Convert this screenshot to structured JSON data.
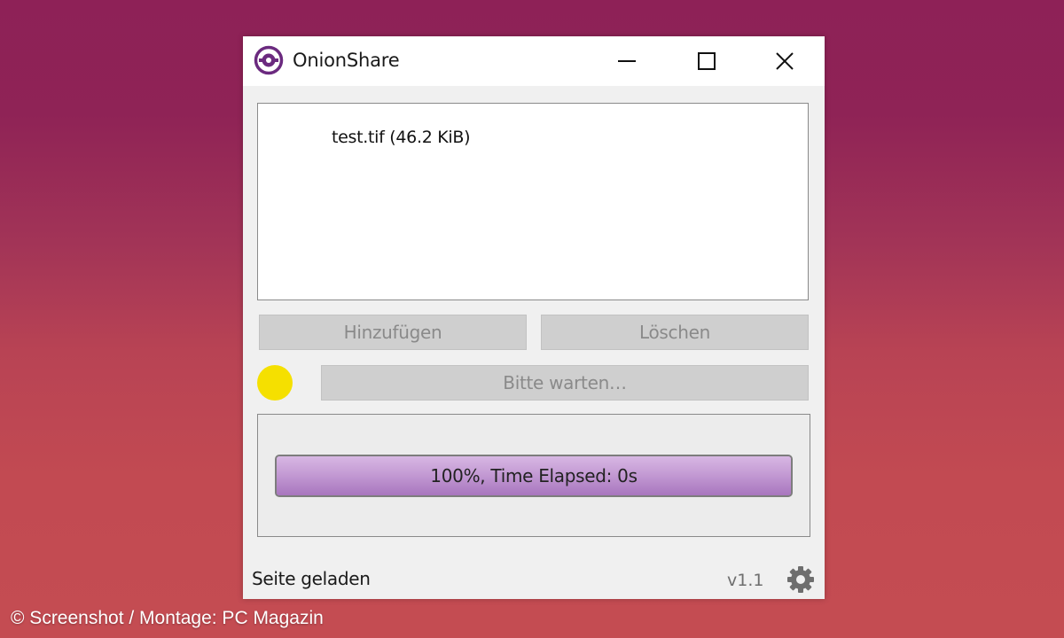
{
  "window": {
    "title": "OnionShare",
    "icons": {
      "app": "onionshare-logo-icon",
      "minimize": "minimize-icon",
      "maximize": "maximize-icon",
      "close": "close-icon"
    }
  },
  "file_list": {
    "items": [
      {
        "label": "test.tif (46.2 KiB)"
      }
    ]
  },
  "buttons": {
    "add_label": "Hinzufügen",
    "delete_label": "Löschen",
    "wait_label": "Bitte warten…"
  },
  "server_status": {
    "indicator_color": "#f5e000"
  },
  "progress": {
    "value": 1.0,
    "label": "100%, Time Elapsed: 0s",
    "fill_color": "#c49bd4"
  },
  "status_bar": {
    "message": "Seite geladen",
    "version": "v1.1",
    "settings_icon": "gear-icon"
  },
  "caption": "© Screenshot / Montage: PC Magazin",
  "colors": {
    "accent": "#6b2a7f",
    "background_top": "#8e2157",
    "background_bottom": "#c44c52"
  }
}
